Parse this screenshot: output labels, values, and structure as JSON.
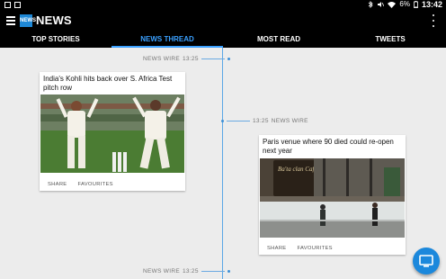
{
  "status_bar": {
    "battery": "6%",
    "time": "13:42"
  },
  "app_bar": {
    "logo_text": "NEWS",
    "title": "NEWS"
  },
  "tabs": [
    {
      "label": "TOP STORIES",
      "active": false
    },
    {
      "label": "NEWS THREAD",
      "active": true
    },
    {
      "label": "MOST READ",
      "active": false
    },
    {
      "label": "TWEETS",
      "active": false
    }
  ],
  "timeline": {
    "markers": [
      {
        "source": "NEWS WIRE",
        "time": "13:25"
      },
      {
        "source": "NEWS WIRE",
        "time": "13:25"
      },
      {
        "source": "NEWS WIRE",
        "time": "13:25"
      }
    ],
    "cards": [
      {
        "title": "India's Kohli hits back over S. Africa Test pitch row",
        "share": "SHARE",
        "favourites": "FAVOURITES"
      },
      {
        "title": "Paris venue where 90 died could re-open next year",
        "share": "SHARE",
        "favourites": "FAVOURITES",
        "image_sign": "Ba'ta clan Café"
      }
    ]
  },
  "fab": {
    "icon": "screen-icon"
  },
  "colors": {
    "accent": "#3aa0ff",
    "timeline": "#5aa7e6",
    "fab": "#1b88dc",
    "bar": "#000000"
  }
}
